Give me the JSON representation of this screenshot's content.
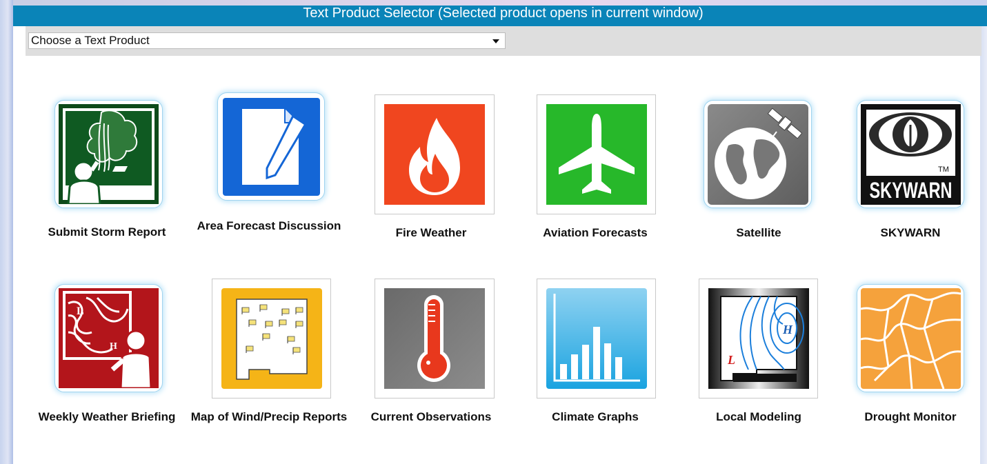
{
  "header": {
    "title": "Text Product Selector (Selected product opens in current window)"
  },
  "selector": {
    "value": "Choose a Text Product"
  },
  "colors": {
    "header_bg": "#0a84b8",
    "select_row_bg": "#dedede"
  },
  "tiles": [
    {
      "label": "Submit Storm Report",
      "icon": "storm-report-icon"
    },
    {
      "label": "Area Forecast Discussion",
      "icon": "document-pen-icon"
    },
    {
      "label": "Fire Weather",
      "icon": "fire-icon"
    },
    {
      "label": "Aviation Forecasts",
      "icon": "airplane-icon"
    },
    {
      "label": "Satellite",
      "icon": "satellite-globe-icon"
    },
    {
      "label": "SKYWARN",
      "icon": "skywarn-logo-icon",
      "logo_text": "SKYWARN"
    },
    {
      "label": "Weekly Weather Briefing",
      "icon": "weather-briefing-icon"
    },
    {
      "label": "Map of Wind/Precip Reports",
      "icon": "report-map-icon"
    },
    {
      "label": "Current Observations",
      "icon": "thermometer-icon"
    },
    {
      "label": "Climate Graphs",
      "icon": "bar-graph-icon"
    },
    {
      "label": "Local Modeling",
      "icon": "isobar-map-icon"
    },
    {
      "label": "Drought Monitor",
      "icon": "cracked-earth-icon"
    }
  ]
}
